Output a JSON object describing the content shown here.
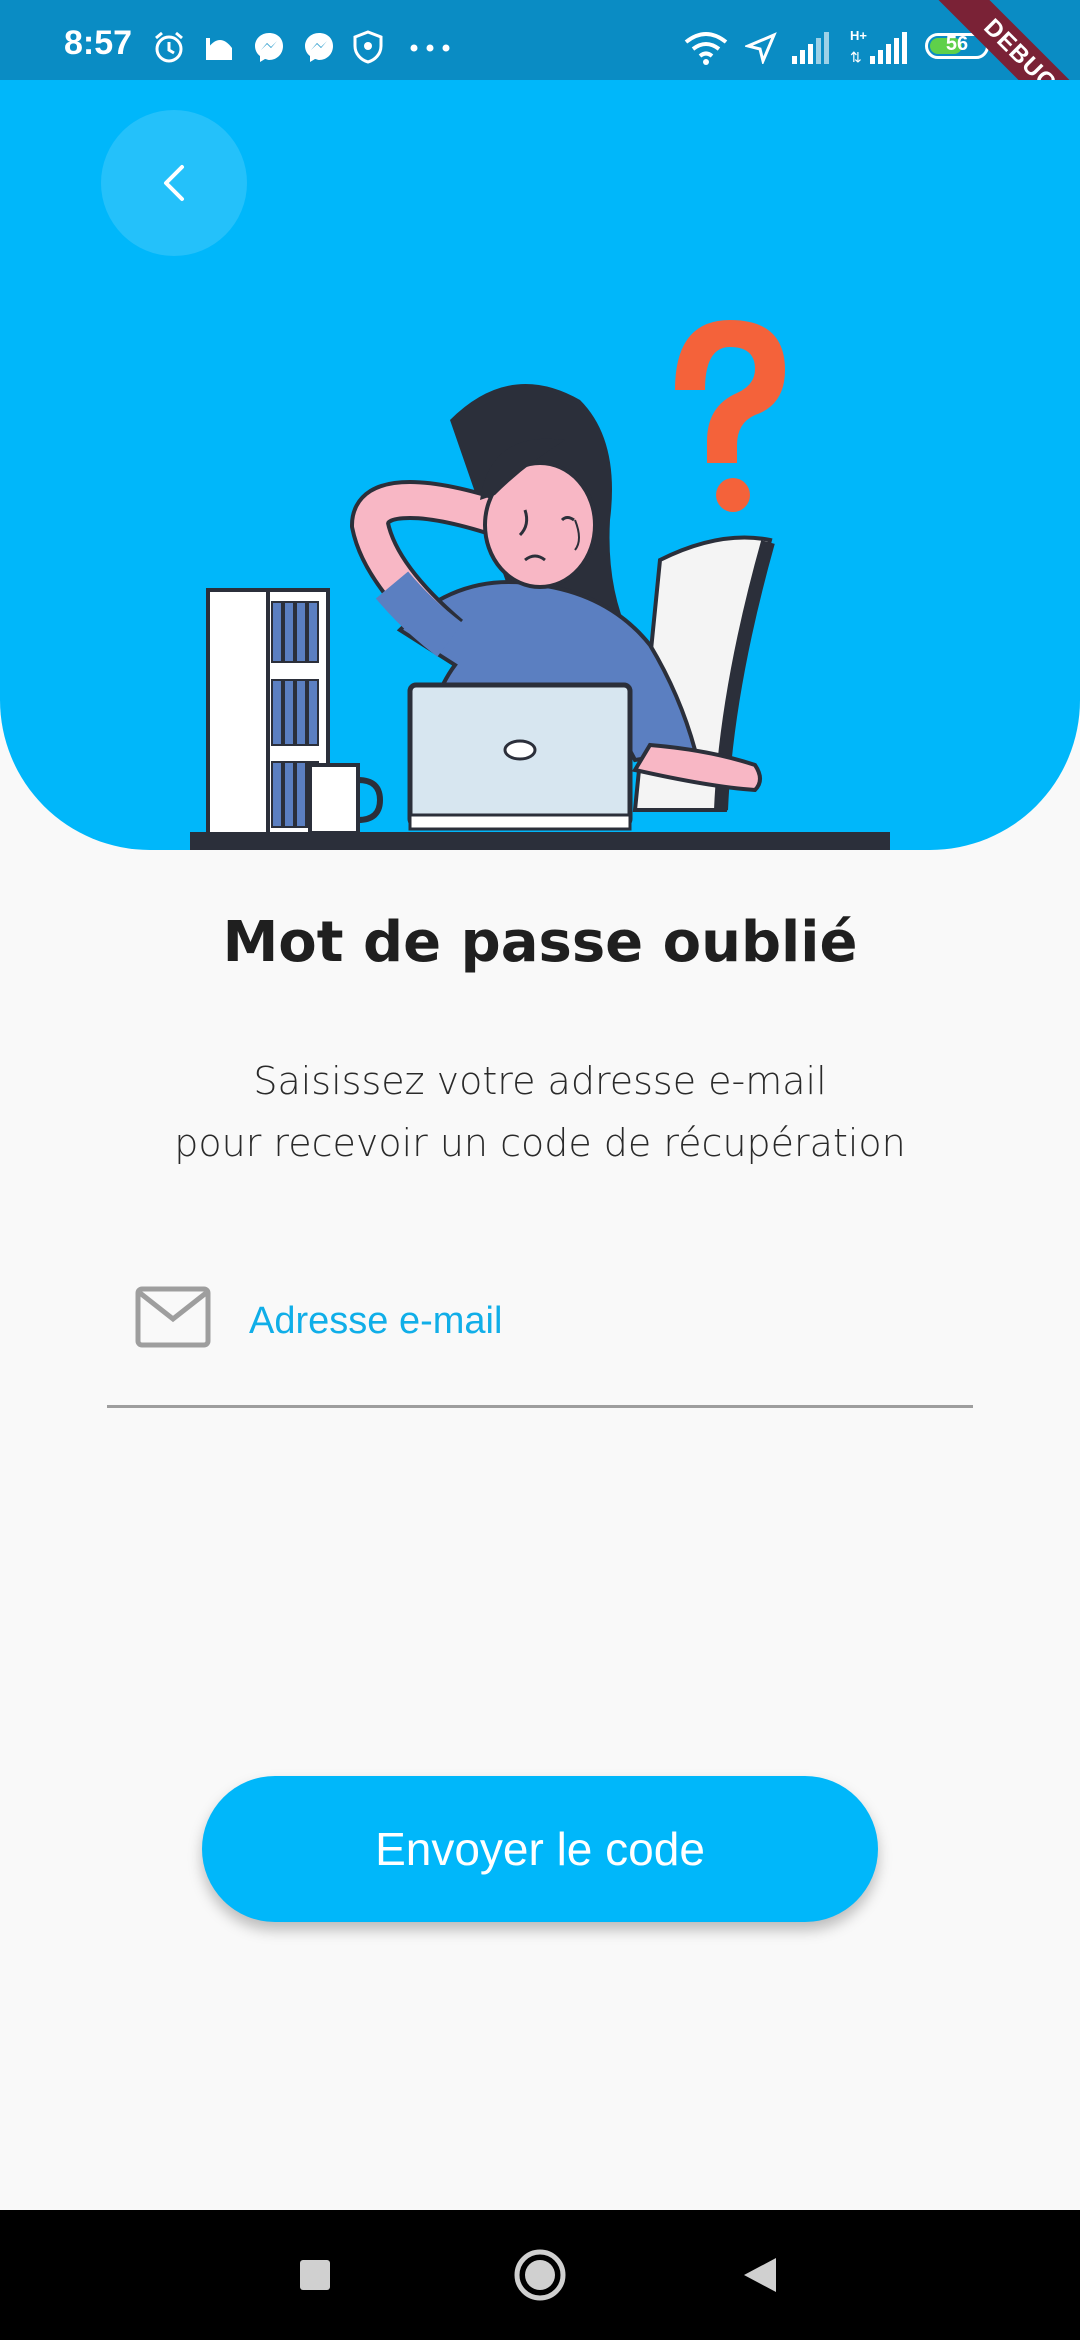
{
  "status_bar": {
    "time": "8:57",
    "battery_level": "56",
    "debug_label": "DEBUG",
    "left_icons": [
      "alarm-icon",
      "mosque-icon",
      "messenger-icon",
      "messenger-icon",
      "shield-icon",
      "more-dots-icon"
    ],
    "right_icons": [
      "wifi-icon",
      "location-icon",
      "signal-icon",
      "h-plus-signal-icon",
      "battery-icon"
    ]
  },
  "header": {
    "back_icon": "chevron-left-icon",
    "illustration": "confused-woman-at-desk-with-question-mark",
    "colors": {
      "background": "#00b7fa",
      "question_mark": "#f4623a"
    }
  },
  "content": {
    "title": "Mot de passe oublié",
    "subtitle_line1": "Saisissez votre adresse e-mail",
    "subtitle_line2": "pour recevoir un code de récupération",
    "email": {
      "placeholder": "Adresse e-mail",
      "value": "",
      "icon": "mail-icon"
    },
    "send_button_label": "Envoyer le code"
  },
  "nav_bar": {
    "buttons": [
      "recents-square-icon",
      "home-circle-icon",
      "back-triangle-icon"
    ]
  },
  "colors": {
    "accent": "#00b7fa",
    "status_bar": "#0a8cc4",
    "text": "#1f1f1f"
  }
}
